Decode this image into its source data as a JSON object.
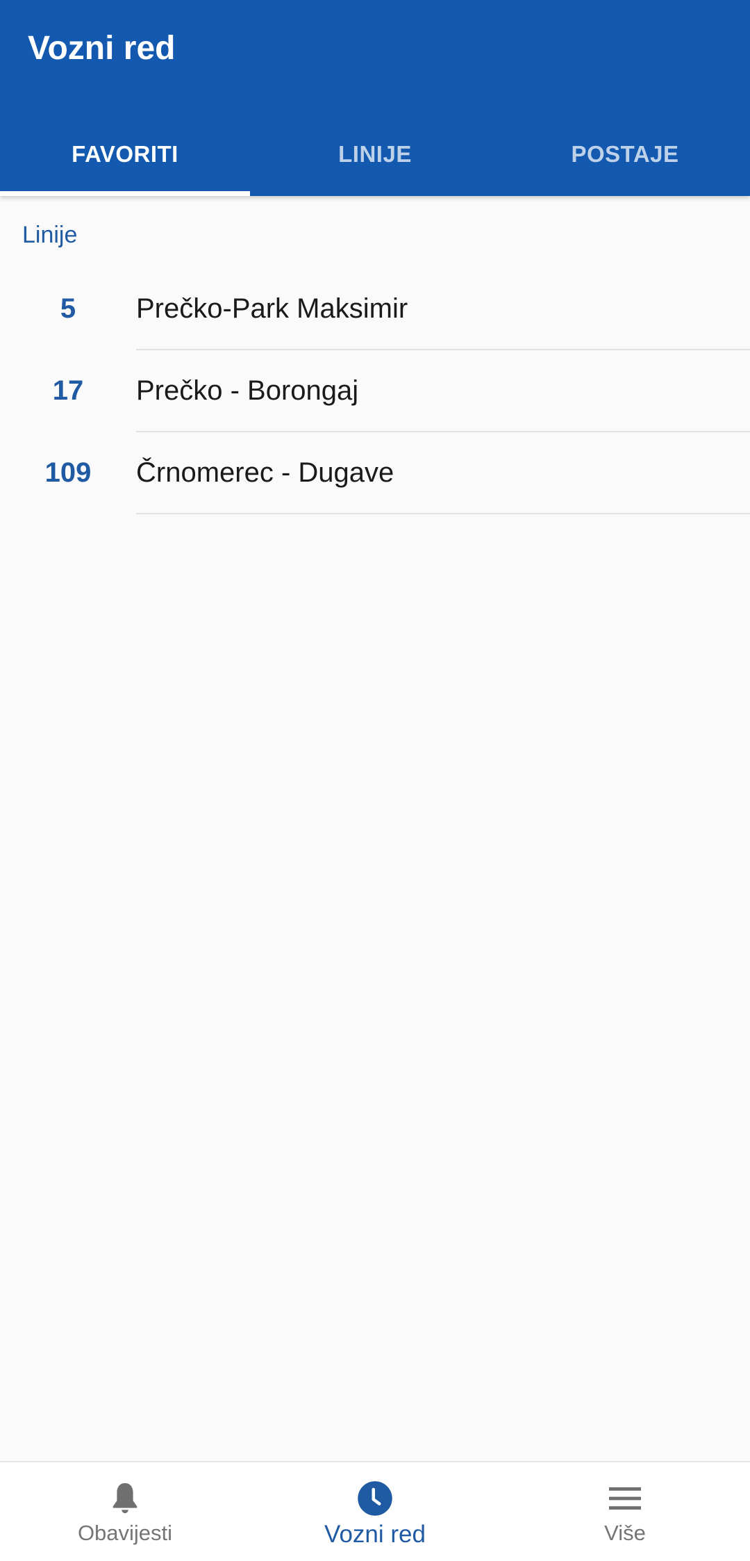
{
  "app_bar": {
    "title": "Vozni red",
    "background_color": "#1359b0"
  },
  "tabs": [
    {
      "label": "FAVORITI",
      "active": true
    },
    {
      "label": "LINIJE",
      "active": false
    },
    {
      "label": "POSTAJE",
      "active": false
    }
  ],
  "favorites": {
    "section_header": "Linije",
    "lines": [
      {
        "number": "5",
        "name": "Prečko-Park Maksimir"
      },
      {
        "number": "17",
        "name": "Prečko - Borongaj"
      },
      {
        "number": "109",
        "name": "Črnomerec - Dugave"
      }
    ]
  },
  "bottom_nav": {
    "items": [
      {
        "label": "Obavijesti",
        "icon": "bell-icon",
        "active": false
      },
      {
        "label": "Vozni red",
        "icon": "clock-icon",
        "active": true
      },
      {
        "label": "Više",
        "icon": "menu-icon",
        "active": false
      }
    ],
    "active_color": "#1f5aa3",
    "inactive_color": "#757575"
  }
}
